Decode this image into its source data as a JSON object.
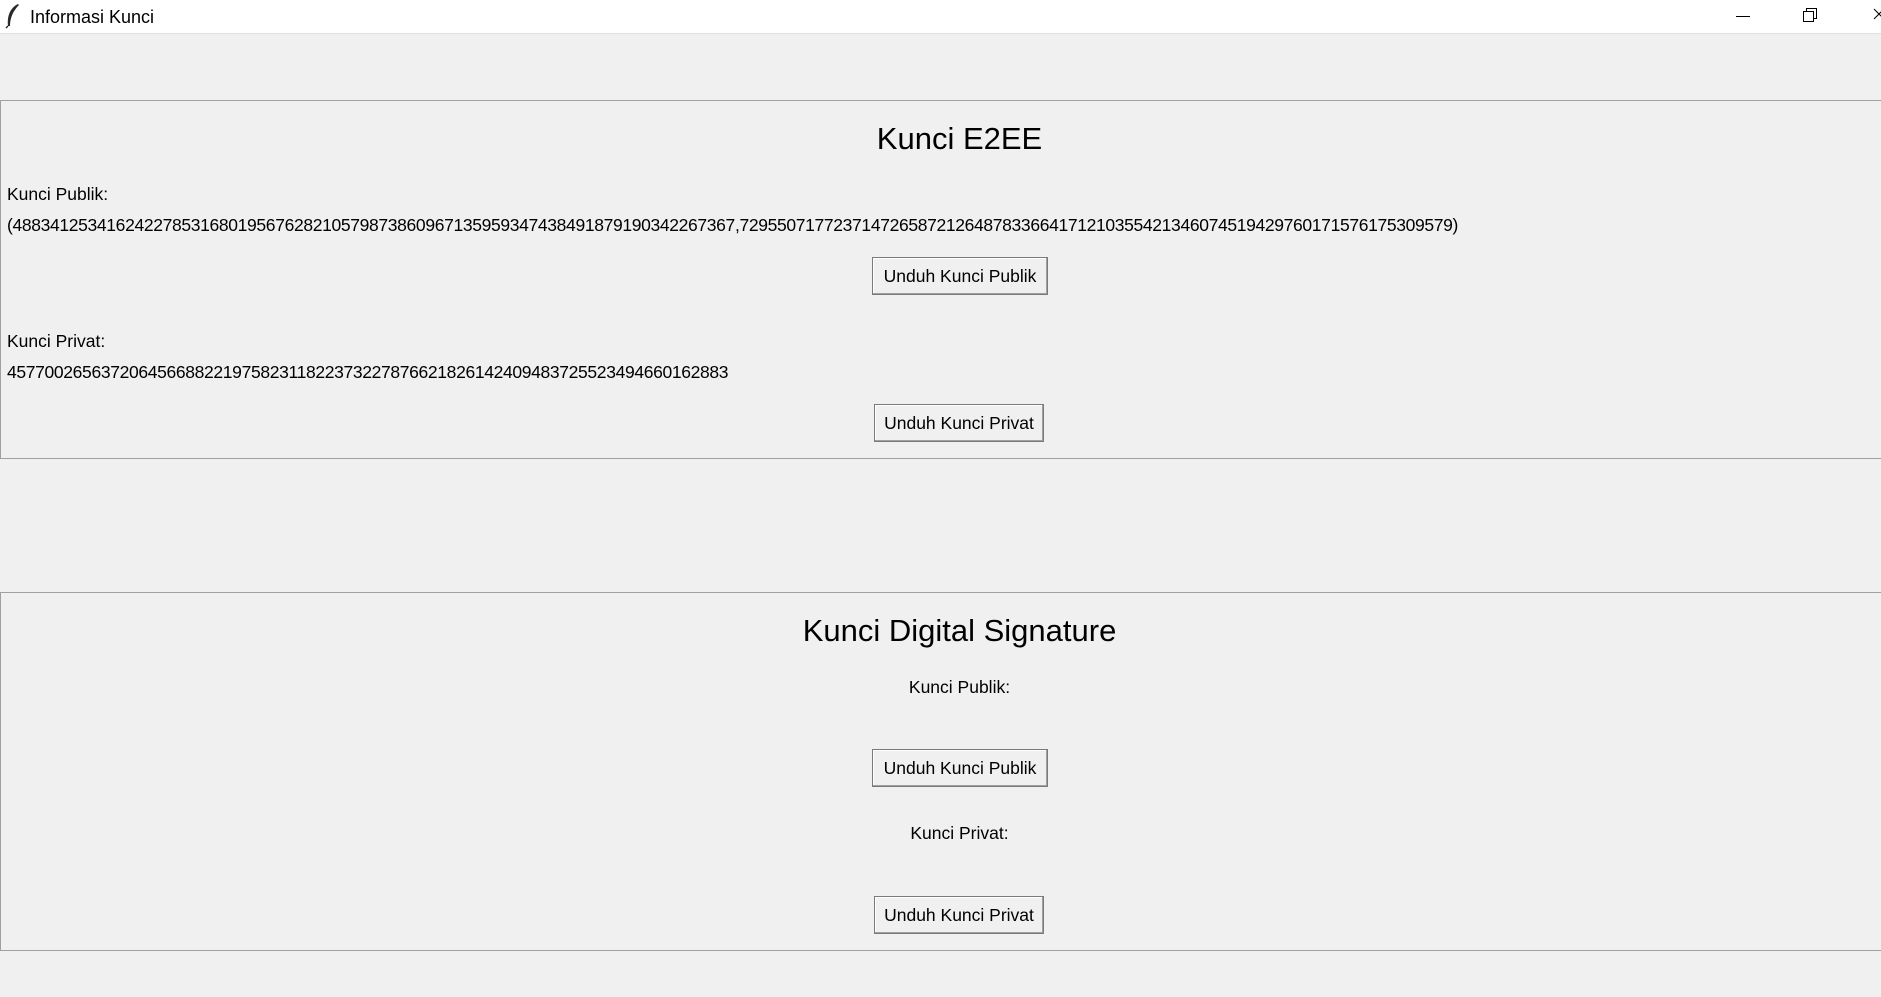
{
  "window": {
    "title": "Informasi Kunci",
    "icon": "feather-icon",
    "controls": [
      "minimize-icon",
      "restore-icon",
      "close-icon"
    ]
  },
  "e2ee": {
    "title": "Kunci E2EE",
    "public_label": "Kunci Publik:",
    "public_value": "(48834125341624227853168019567628210579873860967135959347438491879190342267367,72955071772371472658721264878336641712103554213460745194297601715761753095​79)",
    "download_public": "Unduh Kunci Publik",
    "private_label": "Kunci Privat:",
    "private_value": "45770026563720645668822197582311822373227876621826142409483725523494660162883",
    "download_private": "Unduh Kunci Privat"
  },
  "signature": {
    "title": "Kunci Digital Signature",
    "public_label": "Kunci Publik:",
    "download_public": "Unduh Kunci Publik",
    "private_label": "Kunci Privat:",
    "download_private": "Unduh Kunci Privat"
  }
}
